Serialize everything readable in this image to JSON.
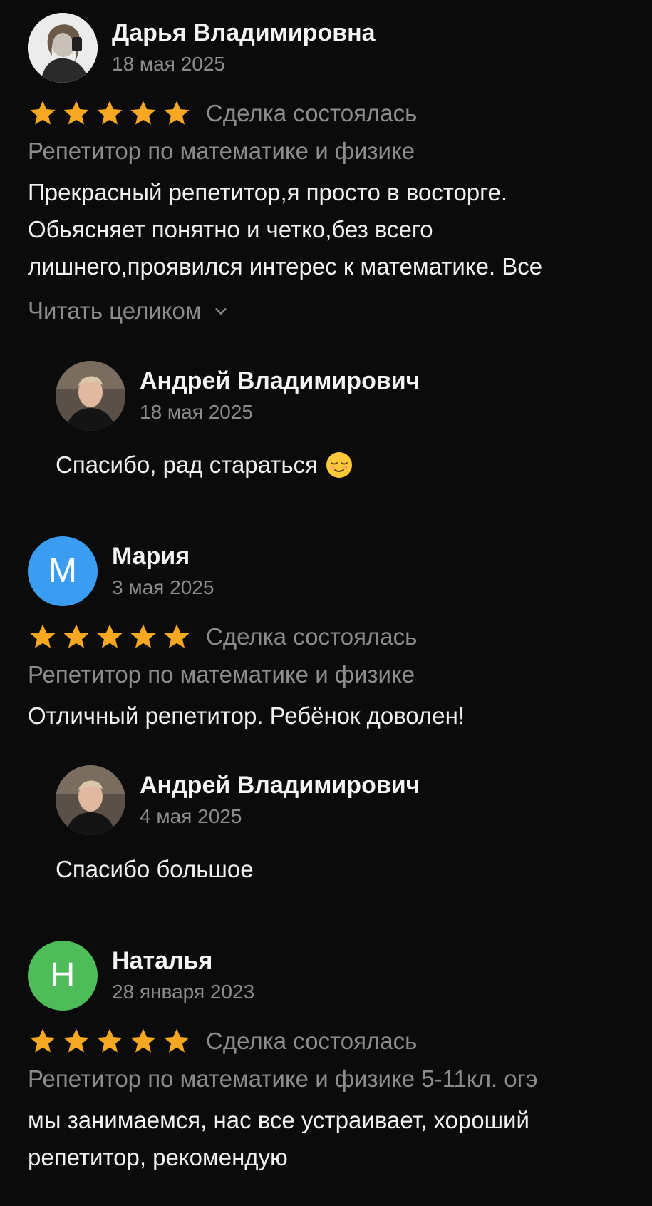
{
  "reviews": [
    {
      "author": "Дарья Владимировна",
      "date": "18 мая 2025",
      "avatar": {
        "type": "photo",
        "description_icon": "user-photo-icon",
        "colors": [
          "#e8e8e8",
          "#3a3a3a"
        ]
      },
      "rating": 5,
      "deal_status": "Сделка состоялась",
      "service": "Репетитор по математике и физике",
      "text_lines": [
        "Прекрасный репетитор,я просто в восторге.",
        "Обьясняет понятно и четко,без всего",
        "лишнего,проявился интерес к математике. Все"
      ],
      "read_more": "Читать целиком",
      "reply": {
        "author": "Андрей Владимирович",
        "date": "18 мая 2025",
        "text": "Спасибо, рад стараться",
        "emoji": "relieved-face-icon"
      }
    },
    {
      "author": "Мария",
      "date": "3 мая 2025",
      "avatar": {
        "type": "letter",
        "letter": "М",
        "color": "#3b9df2"
      },
      "rating": 5,
      "deal_status": "Сделка состоялась",
      "service": "Репетитор по математике и физике",
      "text_lines": [
        "Отличный репетитор. Ребёнок доволен!"
      ],
      "reply": {
        "author": "Андрей Владимирович",
        "date": "4 мая 2025",
        "text": "Спасибо большое"
      }
    },
    {
      "author": "Наталья",
      "date": "28 января 2023",
      "avatar": {
        "type": "letter",
        "letter": "Н",
        "color": "#4fbc5a"
      },
      "rating": 5,
      "deal_status": "Сделка состоялась",
      "service": "Репетитор по математике и физике 5-11кл. огэ",
      "text_lines": [
        "мы занимаемся, нас все устраивает, хороший",
        "репетитор, рекомендую"
      ]
    }
  ],
  "colors": {
    "background": "#0b0b0b",
    "star": "#f7a823",
    "secondary_text": "#8c8c8c",
    "primary_text": "#f0f0f0"
  }
}
